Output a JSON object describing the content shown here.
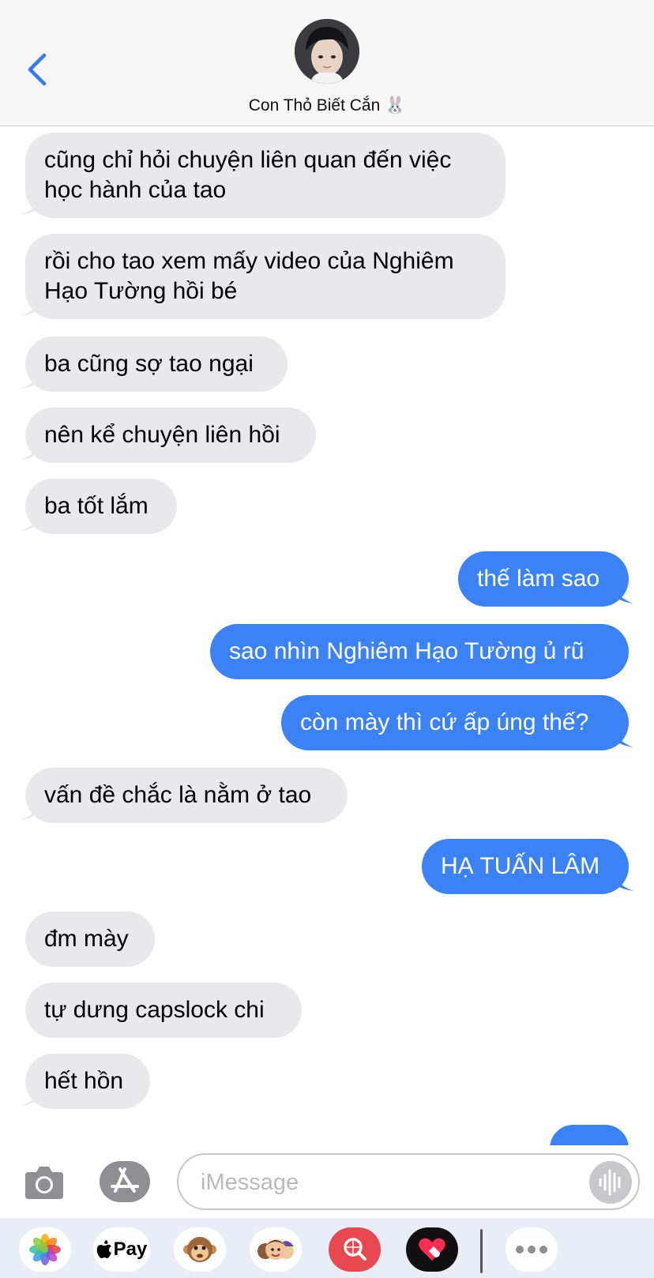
{
  "header": {
    "contact_name": "Con Thỏ Biết Cắn 🐰"
  },
  "messages": [
    {
      "side": "in",
      "lines": [
        "cũng chỉ hỏi chuyện liên quan đến việc",
        "học hành của tao"
      ]
    },
    {
      "side": "in",
      "lines": [
        "rồi cho tao xem mấy video của Nghiêm",
        "Hạo Tường hồi bé"
      ]
    },
    {
      "side": "in",
      "lines": [
        "ba cũng sợ tao ngại"
      ]
    },
    {
      "side": "in",
      "lines": [
        "nên kể chuyện liên hồi"
      ]
    },
    {
      "side": "in",
      "lines": [
        "ba tốt lắm"
      ]
    },
    {
      "side": "out",
      "lines": [
        "thế làm sao"
      ]
    },
    {
      "side": "out",
      "lines": [
        "sao nhìn Nghiêm Hạo Tường ủ rũ"
      ]
    },
    {
      "side": "out",
      "lines": [
        "còn mày thì cứ ấp úng thế?"
      ]
    },
    {
      "side": "in",
      "lines": [
        "vấn đề chắc là nằm ở tao"
      ]
    },
    {
      "side": "out",
      "lines": [
        "HẠ TUẤN LÂM"
      ]
    },
    {
      "side": "in",
      "lines": [
        "đm mày"
      ]
    },
    {
      "side": "in",
      "lines": [
        "tự dưng capslock chi"
      ]
    },
    {
      "side": "in",
      "lines": [
        "hết hồn"
      ]
    }
  ],
  "composer": {
    "placeholder": "iMessage",
    "value": ""
  },
  "apps": {
    "apple_pay_label": "Pay"
  },
  "icons": [
    "chevron-left-icon",
    "camera-icon",
    "app-store-icon",
    "audio-waveform-icon",
    "photos-icon",
    "apple-pay-icon",
    "animoji-icon",
    "memoji-icon",
    "image-search-icon",
    "digital-touch-icon",
    "more-icon"
  ],
  "colors": {
    "incoming_bubble": "#e9e9eb",
    "outgoing_bubble": "#3a82f6",
    "accent": "#3478f6"
  }
}
